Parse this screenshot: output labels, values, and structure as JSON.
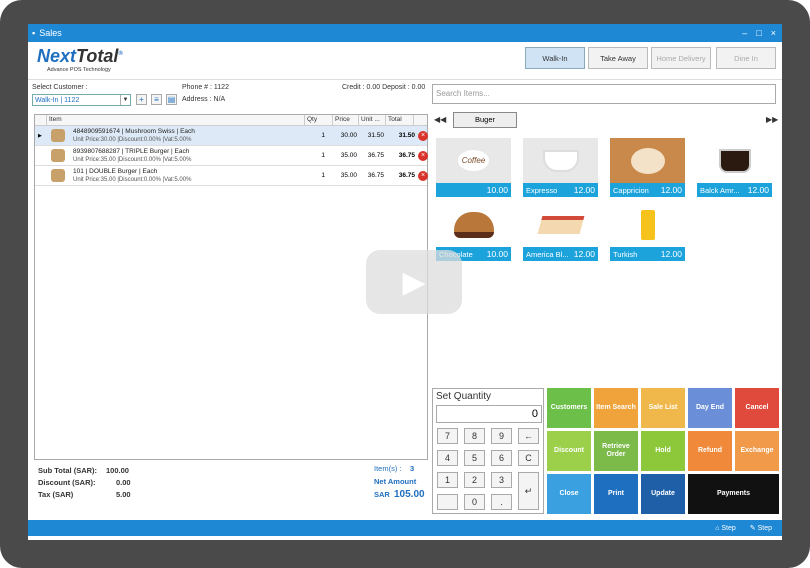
{
  "window": {
    "title": "Sales",
    "controls": [
      "–",
      "□",
      "×"
    ]
  },
  "logo": {
    "name_a": "Next",
    "name_b": "Total",
    "reg": "®",
    "sub": "Advance POS Technology"
  },
  "order_types": [
    {
      "label": "Walk-In",
      "state": "active"
    },
    {
      "label": "Take Away",
      "state": "normal"
    },
    {
      "label": "Home Delivery",
      "state": "disabled"
    },
    {
      "label": "Dine In",
      "state": "disabled"
    }
  ],
  "customer": {
    "label": "Select Customer :",
    "value": "Walk-In | 1122",
    "phone": "Phone # : 1122",
    "address": "Address : N/A",
    "credit": "Credit : 0.00 Deposit : 0.00"
  },
  "grid": {
    "headers": [
      "Item",
      "Qty",
      "Price",
      "Unit ...",
      "Total"
    ],
    "rows": [
      {
        "name": "4848909591674 | Mushroom Swiss | Each",
        "detail": "Unit Price:30.00 |Discount:0.00% |Vat:5.00%",
        "qty": "1",
        "price": "30.00",
        "unit": "31.50",
        "total": "31.50"
      },
      {
        "name": "8939807688287 | TRIPLE Burger | Each",
        "detail": "Unit Price:35.00 |Discount:0.00% |Vat:5.00%",
        "qty": "1",
        "price": "35.00",
        "unit": "36.75",
        "total": "36.75"
      },
      {
        "name": "101 | DOUBLE Burger | Each",
        "detail": "Unit Price:35.00 |Discount:0.00% |Vat:5.00%",
        "qty": "1",
        "price": "35.00",
        "unit": "36.75",
        "total": "36.75"
      }
    ]
  },
  "totals": {
    "subtotal_label": "Sub Total (SAR):",
    "subtotal": "100.00",
    "discount_label": "Discount (SAR):",
    "discount": "0.00",
    "tax_label": "Tax (SAR)",
    "tax": "5.00",
    "items_label": "Item(s) :",
    "items": "3",
    "net_label": "Net Amount",
    "currency": "SAR",
    "net": "105.00"
  },
  "search": {
    "placeholder": "Search Items..."
  },
  "category": "Buger",
  "products": [
    {
      "name": "",
      "price": "10.00"
    },
    {
      "name": "Expresso",
      "price": "12.00"
    },
    {
      "name": "Cappricion",
      "price": "12.00"
    },
    {
      "name": "Balck Amr...",
      "price": "12.00"
    },
    {
      "name": "Chocolate",
      "price": "10.00"
    },
    {
      "name": "America Bl...",
      "price": "12.00"
    },
    {
      "name": "Turkish",
      "price": "12.00"
    }
  ],
  "keypad": {
    "title": "Set Quantity",
    "display": "0",
    "keys": [
      "7",
      "8",
      "9",
      "←",
      "4",
      "5",
      "6",
      "C",
      "1",
      "2",
      "3",
      "",
      "",
      "0",
      ".",
      "↵"
    ]
  },
  "functions": [
    {
      "label": "Customers",
      "color": "#6cc04a"
    },
    {
      "label": "Item Search",
      "color": "#f0a33a"
    },
    {
      "label": "Sale List",
      "color": "#f0b84a"
    },
    {
      "label": "Day End",
      "color": "#6a8fd8"
    },
    {
      "label": "Cancel",
      "color": "#e04a3c"
    },
    {
      "label": "Discount",
      "color": "#9ccf4a"
    },
    {
      "label": "Retrieve Order",
      "color": "#7cba4a"
    },
    {
      "label": "Hold",
      "color": "#8cc83a"
    },
    {
      "label": "Refund",
      "color": "#f08a3a"
    },
    {
      "label": "Exchange",
      "color": "#f09a4a"
    },
    {
      "label": "Close",
      "color": "#3aa0e0"
    },
    {
      "label": "Print",
      "color": "#1e6fbf"
    },
    {
      "label": "Update",
      "color": "#1e5fa8"
    },
    {
      "label": "Payments",
      "color": "#111111"
    }
  ],
  "status": {
    "step1": "Step",
    "step2": "Step"
  }
}
